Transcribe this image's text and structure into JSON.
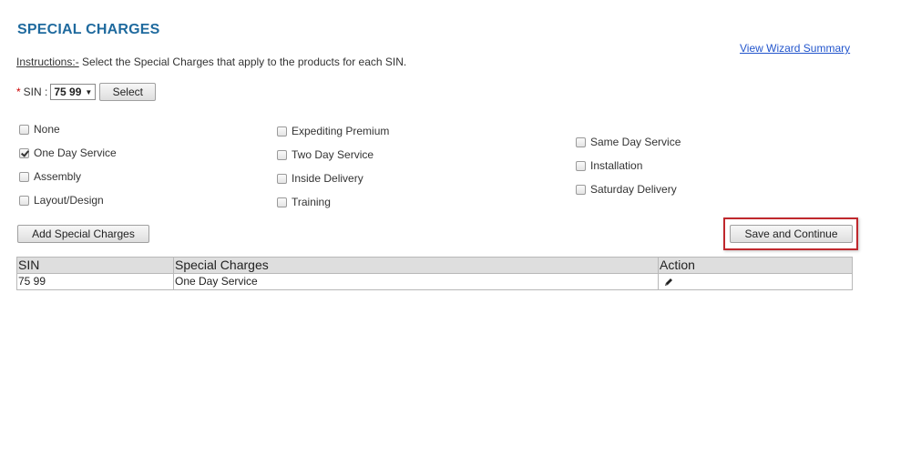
{
  "page": {
    "title": "SPECIAL CHARGES",
    "wizard_link": "View Wizard Summary"
  },
  "instructions": {
    "label": "Instructions:-",
    "text": " Select the Special Charges that apply to the products for each SIN."
  },
  "sin": {
    "required_mark": "*",
    "label": "SIN :",
    "selected": "75 99",
    "select_button": "Select"
  },
  "charges": {
    "col1": [
      {
        "label": "None",
        "checked": false
      },
      {
        "label": "One Day Service",
        "checked": true
      },
      {
        "label": "Assembly",
        "checked": false
      },
      {
        "label": "Layout/Design",
        "checked": false
      }
    ],
    "col2": [
      {
        "label": "Expediting Premium",
        "checked": false
      },
      {
        "label": "Two Day Service",
        "checked": false
      },
      {
        "label": "Inside Delivery",
        "checked": false
      },
      {
        "label": "Training",
        "checked": false
      }
    ],
    "col3": [
      {
        "label": "Same Day Service",
        "checked": false
      },
      {
        "label": "Installation",
        "checked": false
      },
      {
        "label": "Saturday Delivery",
        "checked": false
      }
    ]
  },
  "buttons": {
    "add": "Add Special Charges",
    "save": "Save and Continue"
  },
  "table": {
    "headers": [
      "SIN",
      "Special Charges",
      "Action"
    ],
    "rows": [
      {
        "sin": "75 99",
        "charges": "One Day Service",
        "action_icon": "pencil-icon"
      }
    ]
  },
  "colors": {
    "title": "#1f6a9e",
    "highlight_border": "#c0282d",
    "link": "#2255cc"
  }
}
